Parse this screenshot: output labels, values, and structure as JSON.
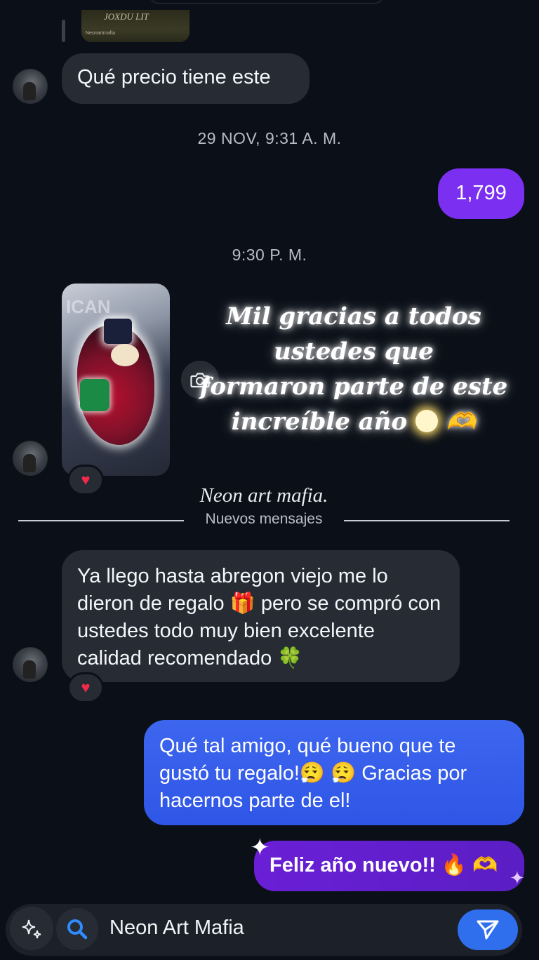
{
  "thread": {
    "messages": {
      "m1": "Qué precio tiene este",
      "m2": "1,799",
      "m3": "Ya llego hasta abregon viejo me lo dieron de regalo 🎁 pero se compró con ustedes todo muy bien excelente calidad recomendado 🍀",
      "m4": "Qué tal amigo, qué bueno que te gustó tu regalo!😮‍💨 😮‍💨  Gracias por hacernos parte de el!",
      "m5": "Feliz año nuevo!! 🔥 🫶"
    },
    "timestamps": {
      "t1": "29 NOV, 9:31 A. M.",
      "t2": "9:30 P. M."
    },
    "shared_post": {
      "image_text": "ICAN",
      "caption_line1": "Mil gracias a todos ustedes que",
      "caption_line2": "formaron parte de este",
      "caption_line3": "increíble año",
      "caption_emoji": "🫶",
      "signature": "Neon art mafia."
    },
    "previous_thumb": {
      "title": "JOXDU LIT",
      "account": "Neonartmafia"
    },
    "new_messages_label": "Nuevos mensajes",
    "reaction_emoji": "♥"
  },
  "composer": {
    "text": "Neon Art Mafia"
  },
  "colors": {
    "background": "#0b1018",
    "received_bubble": "#262b34",
    "sent_purple": "#7b2ff0",
    "sent_blue": "#3460ea",
    "send_button": "#2f6fee"
  }
}
